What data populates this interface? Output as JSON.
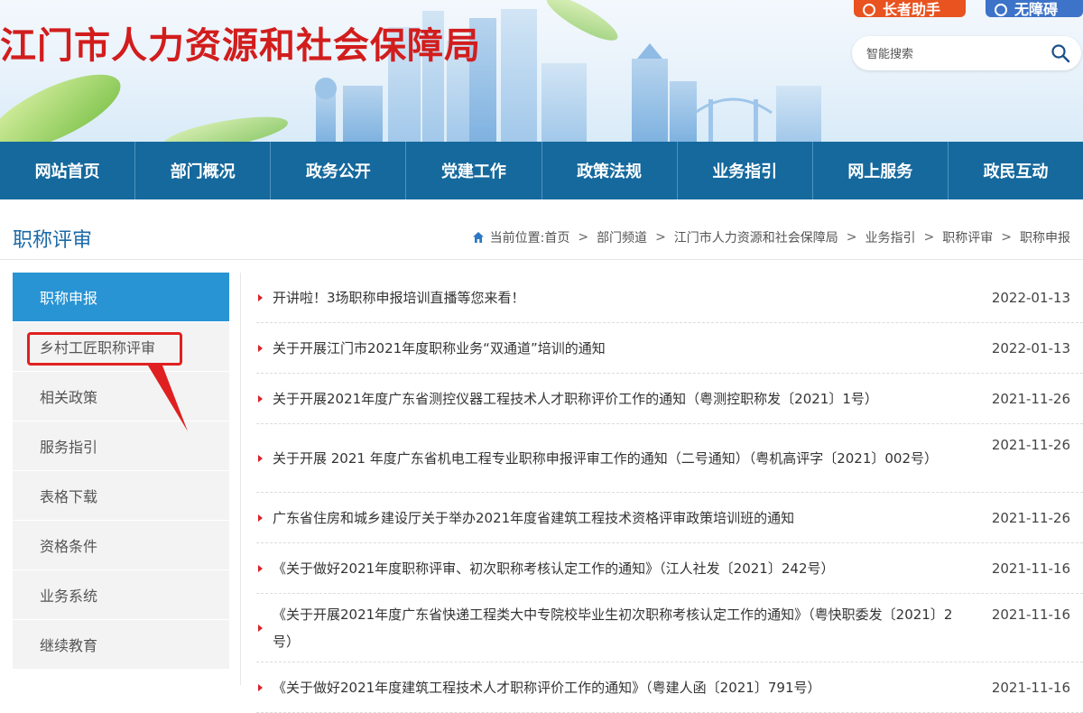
{
  "header": {
    "site_title": "江门市人力资源和社会保障局",
    "elder_button": "长者助手",
    "accessibility_button": "无障碍",
    "search_placeholder": "智能搜索"
  },
  "nav": {
    "items": [
      "网站首页",
      "部门概况",
      "政务公开",
      "党建工作",
      "政策法规",
      "业务指引",
      "网上服务",
      "政民互动"
    ]
  },
  "section": {
    "title": "职称评审",
    "breadcrumb_prefix": "当前位置:",
    "breadcrumb": [
      "首页",
      "部门频道",
      "江门市人力资源和社会保障局",
      "业务指引",
      "职称评审",
      "职称申报"
    ]
  },
  "sidebar": {
    "items": [
      "职称申报",
      "乡村工匠职称评审",
      "相关政策",
      "服务指引",
      "表格下载",
      "资格条件",
      "业务系统",
      "继续教育"
    ],
    "active_index": 0,
    "highlighted_index": 1
  },
  "news": [
    {
      "title": "开讲啦！3场职称申报培训直播等您来看！",
      "date": "2022-01-13"
    },
    {
      "title": "关于开展江门市2021年度职称业务“双通道”培训的通知",
      "date": "2022-01-13"
    },
    {
      "title": "关于开展2021年度广东省测控仪器工程技术人才职称评价工作的通知（粤测控职称发〔2021〕1号）",
      "date": "2021-11-26"
    },
    {
      "title": "关于开展 2021 年度广东省机电工程专业职称申报评审工作的通知（二号通知）（粤机高评字〔2021〕002号）",
      "date": "2021-11-26"
    },
    {
      "title": "广东省住房和城乡建设厅关于举办2021年度省建筑工程技术资格评审政策培训班的通知",
      "date": "2021-11-26"
    },
    {
      "title": "《关于做好2021年度职称评审、初次职称考核认定工作的通知》（江人社发〔2021〕242号）",
      "date": "2021-11-16"
    },
    {
      "title": "《关于开展2021年度广东省快递工程类大中专院校毕业生初次职称考核认定工作的通知》（粤快职委发〔2021〕2号）",
      "date": "2021-11-16"
    },
    {
      "title": "《关于做好2021年度建筑工程技术人才职称评价工作的通知》（粤建人函〔2021〕791号）",
      "date": "2021-11-16"
    }
  ],
  "colors": {
    "title_red": "#d21d1d",
    "nav_blue": "#15699d",
    "active_blue": "#2894d4",
    "highlight_red": "#e02020"
  }
}
